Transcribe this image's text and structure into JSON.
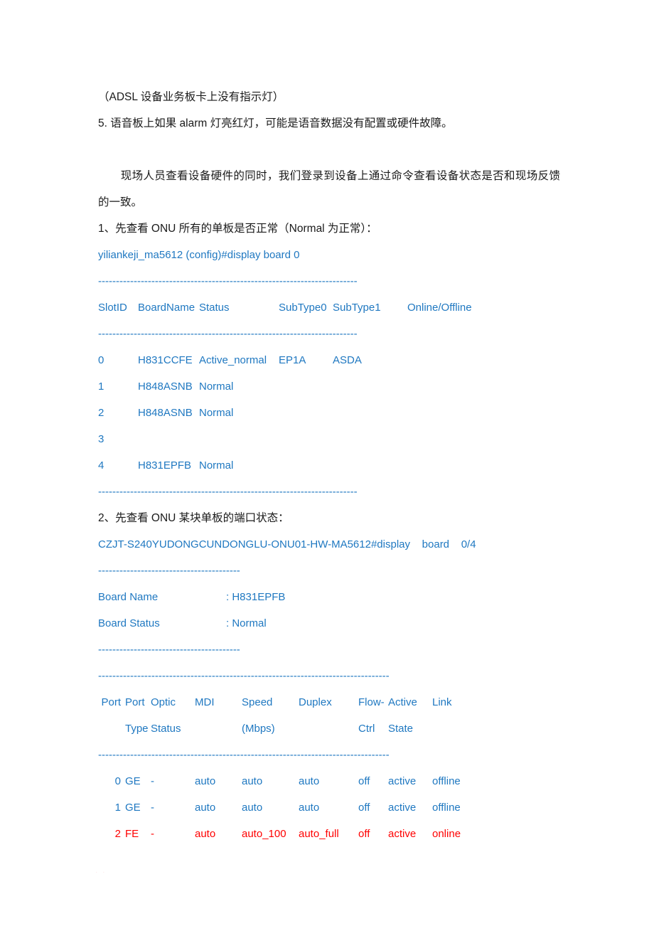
{
  "colors": {
    "cli_blue": "#1f78c1",
    "alert_red": "#ff0000",
    "body_text": "#1a1a1a",
    "page_background": "#ffffff"
  },
  "document": {
    "note_adsl": "（ADSL 设备业务板卡上没有指示灯）",
    "item5": "5. 语音板上如果 alarm 灯亮红灯，可能是语音数据没有配置或硬件故障。",
    "paragraph_intro": "　　现场人员查看设备硬件的同时，我们登录到设备上通过命令查看设备状态是否和现场反馈的一致。",
    "heading1": "1、先查看 ONU 所有的单板是否正常（Normal 为正常）：",
    "heading2": "2、先查看 ONU 某块单板的端口状态："
  },
  "separators": {
    "board_rule": "-------------------------------------------------------------------------",
    "short_rule": "----------------------------------------",
    "port_rule": "----------------------------------------------------------------------------------"
  },
  "board_console": {
    "prompt_command": "yiliankeji_ma5612 (config)#display board 0",
    "headers": [
      "SlotID",
      "BoardName",
      "Status",
      "SubType0",
      "SubType1",
      "Online/Offline"
    ],
    "rows": [
      [
        "0",
        "H831CCFE",
        "Active_normal",
        "EP1A",
        "ASDA",
        ""
      ],
      [
        "1",
        "H848ASNB",
        "Normal",
        "",
        "",
        ""
      ],
      [
        "2",
        "H848ASNB",
        "Normal",
        "",
        "",
        ""
      ],
      [
        "3",
        "",
        "",
        "",
        "",
        ""
      ],
      [
        "4",
        "H831EPFB",
        "Normal",
        "",
        "",
        ""
      ]
    ]
  },
  "port_console": {
    "prompt_command": "CZJT-S240YUDONGCUNDONGLU-ONU01-HW-MA5612#display    board    0/4",
    "board_info": [
      {
        "key": "Board Name",
        "value": ": H831EPFB"
      },
      {
        "key": "Board Status",
        "value": ": Normal"
      }
    ],
    "headers_line1": [
      "Port",
      "Port",
      "Optic",
      "MDI",
      "Speed",
      "Duplex",
      "Flow-",
      "Active",
      "Link"
    ],
    "headers_line2": [
      "",
      "Type",
      "Status",
      "",
      "(Mbps)",
      "",
      "Ctrl",
      "State",
      ""
    ],
    "rows": [
      {
        "highlight": false,
        "cells": [
          "0",
          "GE",
          "-",
          "auto",
          "auto",
          "auto",
          "off",
          "active",
          "offline"
        ]
      },
      {
        "highlight": false,
        "cells": [
          "1",
          "GE",
          "-",
          "auto",
          "auto",
          "auto",
          "off",
          "active",
          "offline"
        ]
      },
      {
        "highlight": true,
        "cells": [
          "2",
          "FE",
          "-",
          "auto",
          "auto_100",
          "auto_full",
          "off",
          "active",
          "online"
        ]
      }
    ]
  }
}
